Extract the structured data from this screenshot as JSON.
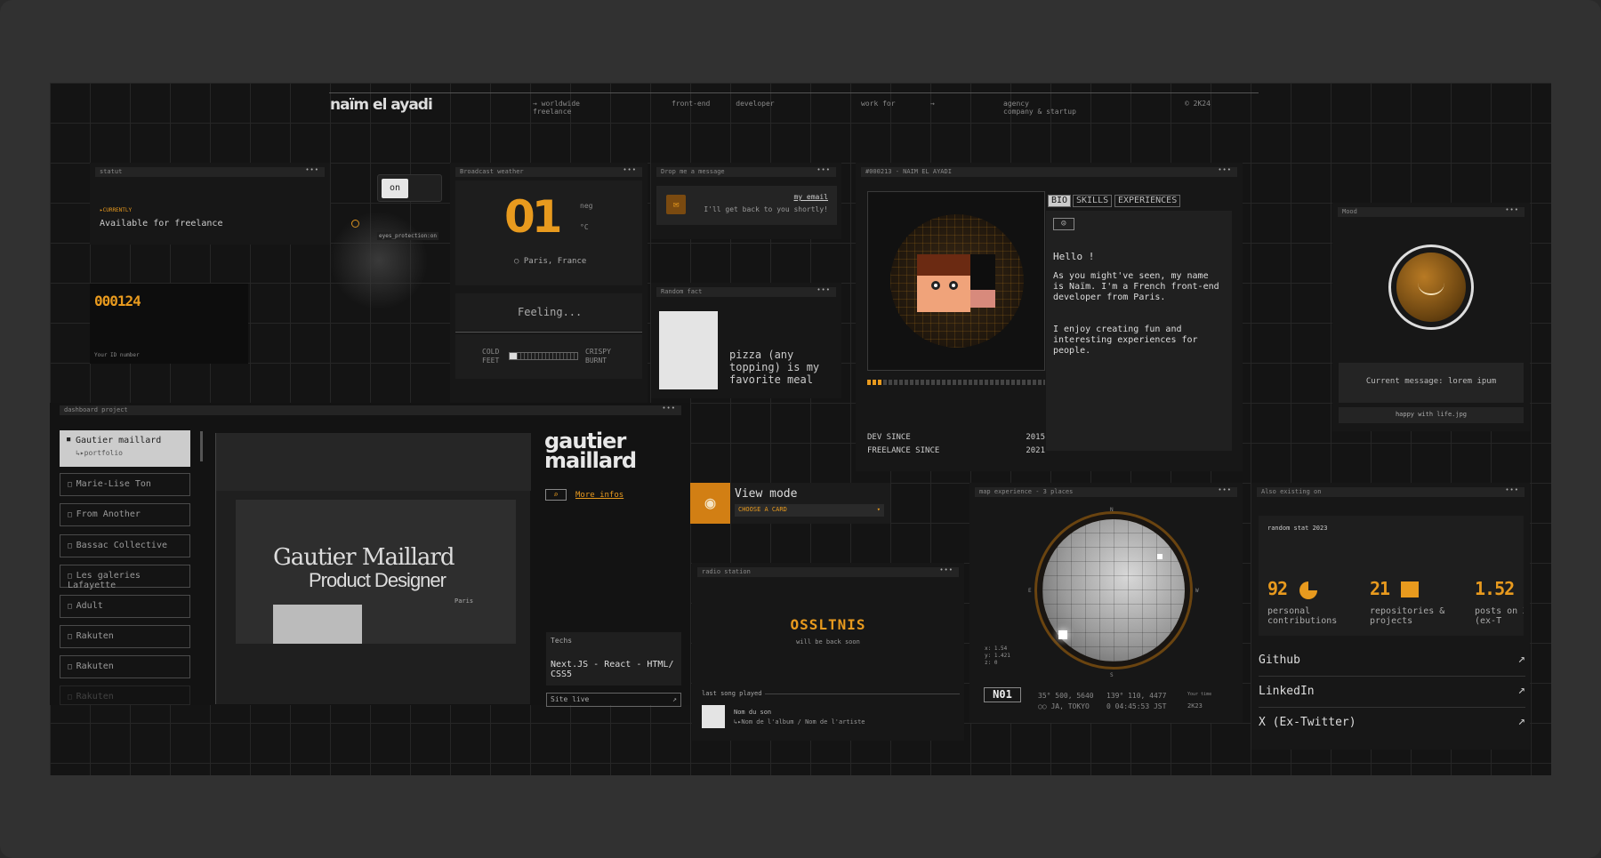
{
  "header": {
    "logo": "naïm el ayadi",
    "tagline1": "→ worldwide",
    "tagline2": "freelance",
    "role1": "front-end",
    "role2": "developer",
    "work": "work for",
    "arrow": "→",
    "agency1": "agency",
    "agency2": "company & startup",
    "year": "© 2K24"
  },
  "status": {
    "title": "statut",
    "label": "▸CURRENTLY",
    "text": "Available for freelance",
    "id_number": "000124",
    "id_label": "Your ID number"
  },
  "eyes": {
    "toggle": "on",
    "label": "eyes_protection:on"
  },
  "weather": {
    "title": "Broadcast weather",
    "temp": "01",
    "neg": "neg",
    "unit": "°C",
    "location": "○ Paris, France",
    "feeling": "Feeling...",
    "cold": "COLD",
    "feet": "FEET",
    "crispy": "CRISPY",
    "burnt": "BURNT"
  },
  "message": {
    "title": "Drop me a message",
    "email": "my email",
    "text": "I'll get back to you shortly!"
  },
  "fact": {
    "title": "Random fact",
    "text": "pizza (any topping) is my favorite meal"
  },
  "bio": {
    "title": "#000213 - NAIM EL AYADI",
    "tabs": [
      "BIO",
      "SKILLS",
      "EXPERIENCES"
    ],
    "hello": "Hello !",
    "p1": "As you might've seen, my name is Naïm. I'm a French front-end developer from Paris.",
    "p2": "I enjoy creating fun and interesting experiences for people.",
    "dev_since": "DEV SINCE",
    "dev_year": "2015",
    "freelance_since": "FREELANCE SINCE",
    "freelance_year": "2021"
  },
  "mood": {
    "title": "Mood",
    "message": "Current message: lorem ipum",
    "file": "happy with life.jpg"
  },
  "project": {
    "title": "dashboard project",
    "items": [
      "Gautier maillard",
      "Marie-Lise Ton",
      "From Another",
      "Bassac Collective",
      "Les galeries Lafayette",
      "Adult",
      "Rakuten",
      "Rakuten",
      "Rakuten"
    ],
    "sub": "↳▸portfolio",
    "preview_name": "Gautier Maillard",
    "preview_role": "Product Designer",
    "preview_city": "Paris",
    "brand1": "gautier",
    "brand2": "maillard",
    "more": "More infos",
    "techs_label": "Techs",
    "techs": "Next.JS - React - HTML/ CSS5",
    "site": "Site live",
    "site_arrow": "↗"
  },
  "view": {
    "title": "View mode",
    "select": "CHOOSE A CARD"
  },
  "radio": {
    "title": "radio station",
    "logo": "OSSLTNIS",
    "status": "will be back soon",
    "last": "last song played",
    "song": "Nom du son",
    "album": "↳▸Nom de l'album / Nom de l'artiste"
  },
  "map": {
    "title": "map experience - 3 places",
    "x": "x: 1.54",
    "y": "y: 1.421",
    "z": "z: 0",
    "badge": "N01",
    "coord1": "35° 500, 5640",
    "coord2": "139° 110, 4477",
    "loc": "○○ JA, TOKYO",
    "time": "0 04:45:53 JST",
    "time_label": "Your time",
    "year": "2K23",
    "n": "N",
    "s": "S",
    "e": "E",
    "w": "W"
  },
  "social": {
    "title": "Also existing on",
    "stat_title": "random stat 2023",
    "stats": [
      {
        "num": "92",
        "label": "personal contributions"
      },
      {
        "num": "21",
        "label": "repositories & projects"
      },
      {
        "num": "1.52",
        "label": "posts on X (ex-T"
      }
    ],
    "links": [
      "Github",
      "LinkedIn",
      "X (Ex-Twitter)"
    ],
    "arrow": "↗"
  }
}
